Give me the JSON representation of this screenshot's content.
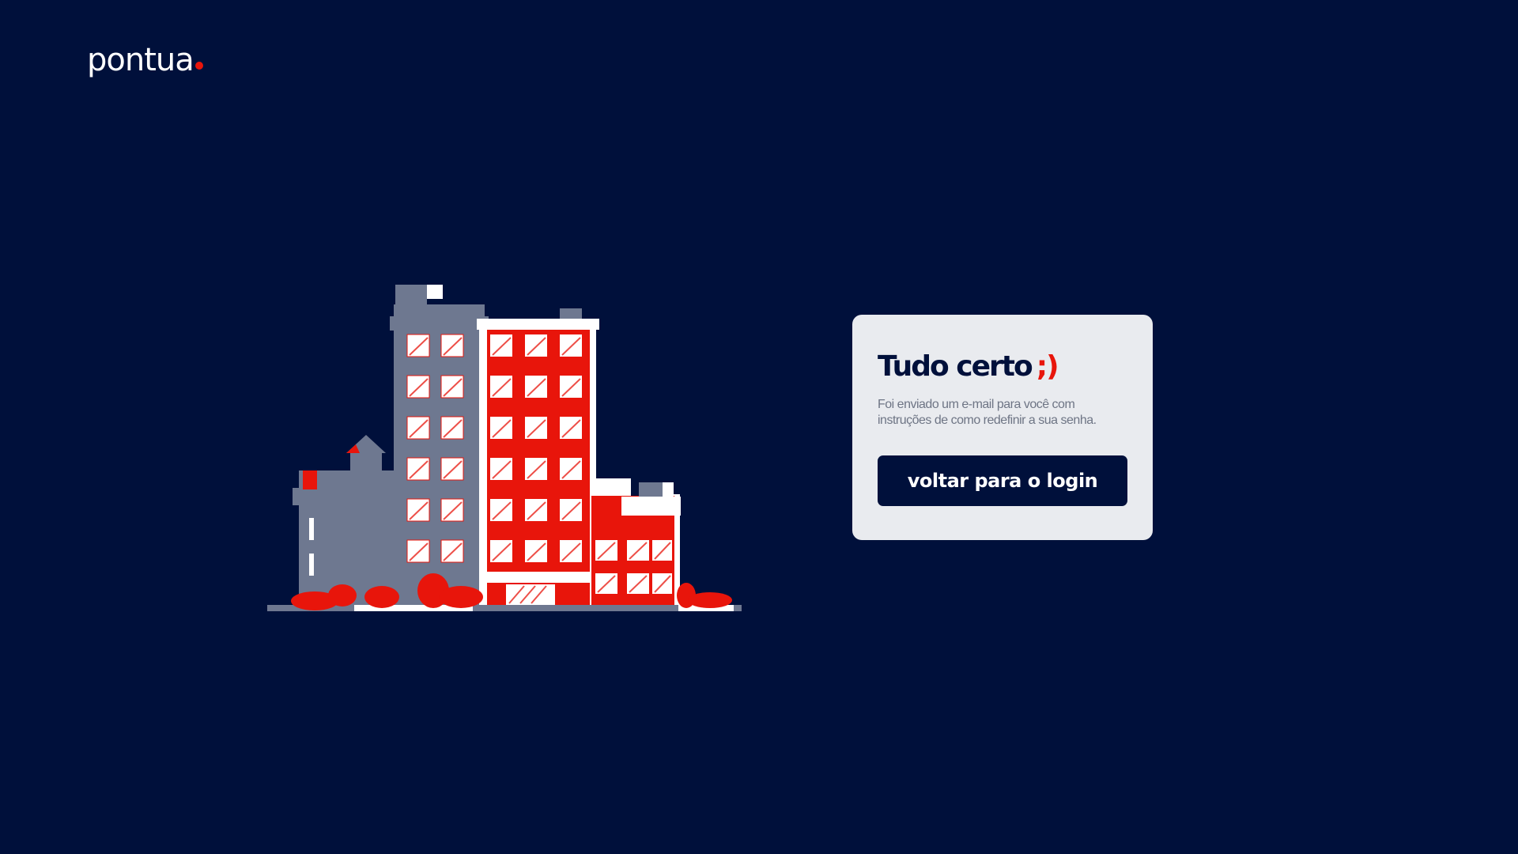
{
  "brand": {
    "logo_text": "pontua",
    "accent_color": "#e8150b",
    "background_color": "#00103b"
  },
  "illustration": {
    "icon": "city-buildings-illustration"
  },
  "card": {
    "title": "Tudo certo",
    "title_emoticon": ";)",
    "message": "Foi enviado um e-mail para você com instruções de como redefinir a sua senha.",
    "button_label": "voltar para o login"
  }
}
